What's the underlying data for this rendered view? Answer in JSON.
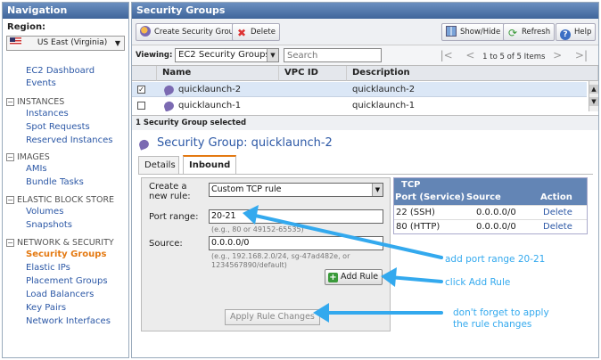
{
  "nav": {
    "header": "Navigation",
    "region_label": "Region:",
    "region_value": "US East (Virginia)",
    "links_top": [
      "EC2 Dashboard",
      "Events"
    ],
    "sections": [
      {
        "title": "INSTANCES",
        "items": [
          "Instances",
          "Spot Requests",
          "Reserved Instances"
        ]
      },
      {
        "title": "IMAGES",
        "items": [
          "AMIs",
          "Bundle Tasks"
        ]
      },
      {
        "title": "ELASTIC BLOCK STORE",
        "items": [
          "Volumes",
          "Snapshots"
        ]
      },
      {
        "title": "NETWORK & SECURITY",
        "items": [
          "Security Groups",
          "Elastic IPs",
          "Placement Groups",
          "Load Balancers",
          "Key Pairs",
          "Network Interfaces"
        ]
      }
    ]
  },
  "main": {
    "header": "Security Groups",
    "toolbar": {
      "create": "Create Security Group",
      "delete": "Delete",
      "showhide": "Show/Hide",
      "refresh": "Refresh",
      "help": "Help"
    },
    "viewing_label": "Viewing:",
    "view_value": "EC2 Security Groups",
    "search_placeholder": "Search",
    "pager_text": "1 to 5 of 5 Items",
    "columns": [
      "Name",
      "VPC ID",
      "Description"
    ],
    "rows": [
      {
        "name": "quicklaunch-2",
        "vpc": "",
        "description": "quicklaunch-2",
        "checked": "✓"
      },
      {
        "name": "quicklaunch-1",
        "vpc": "",
        "description": "quicklaunch-1",
        "checked": ""
      }
    ],
    "selected_count": "1 Security Group selected",
    "detail_title": "Security Group: quicklaunch-2",
    "tabs": [
      "Details",
      "Inbound"
    ],
    "form": {
      "create_label": "Create a\nnew rule:",
      "rule_type": "Custom TCP rule",
      "port_label": "Port range:",
      "port_value": "20-21",
      "port_hint": "(e.g., 80 or 49152-65535)",
      "source_label": "Source:",
      "source_value": "0.0.0.0/0",
      "source_hint_1": "(e.g., 192.168.2.0/24, sg-47ad482e, or",
      "source_hint_2": "1234567890/default)",
      "add_rule": "Add Rule",
      "apply": "Apply Rule Changes"
    },
    "tcp": {
      "title": "TCP",
      "col_port": "Port (Service)",
      "col_source": "Source",
      "col_action": "Action",
      "rows": [
        {
          "port": "22 (SSH)",
          "source": "0.0.0.0/0",
          "action": "Delete"
        },
        {
          "port": "80 (HTTP)",
          "source": "0.0.0.0/0",
          "action": "Delete"
        }
      ]
    }
  },
  "callouts": {
    "port": "add port range 20-21",
    "add": "click Add Rule",
    "apply_1": "don't forget to apply",
    "apply_2": "the rule changes"
  },
  "colors": {
    "accent": "#e47911",
    "link": "#2c58a6",
    "callout": "#33a9ee",
    "header": "#4a73a9"
  }
}
